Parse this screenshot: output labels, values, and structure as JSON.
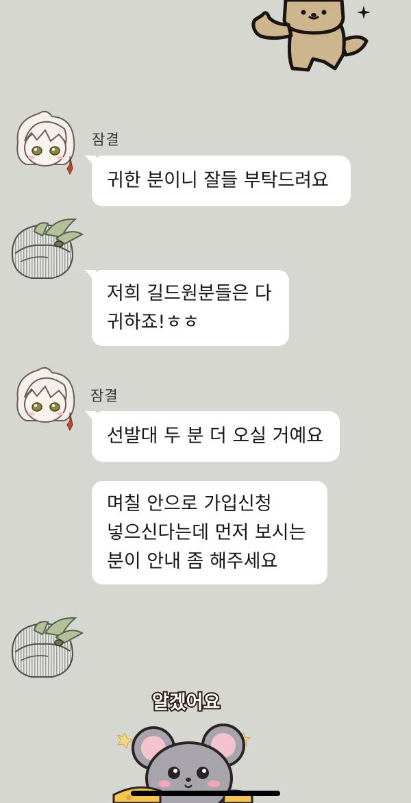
{
  "messages": [
    {
      "sender": "잠결",
      "lines": [
        "귀한 분이니 잘들 부탁드려요"
      ]
    },
    {
      "sender": "",
      "lines": [
        "저희 길드원분들은 다",
        "귀하죠!ㅎㅎ"
      ]
    },
    {
      "sender": "잠결",
      "lines": [
        "선발대 두 분 더 오실 거예요"
      ]
    },
    {
      "sender": "",
      "lines": [
        "며칠 안으로 가입신청",
        "넣으신다는데 먼저 보시는",
        "분이 안내 좀 해주세요"
      ]
    }
  ],
  "stickers": {
    "bear": {
      "icon": "bear-thumbs-up-sticker"
    },
    "mouse": {
      "icon": "mouse-cheese-sticker",
      "text": "알겠어요"
    }
  },
  "colors": {
    "background": "#d6d7d1",
    "bubble": "#ffffff",
    "text": "#161616"
  }
}
